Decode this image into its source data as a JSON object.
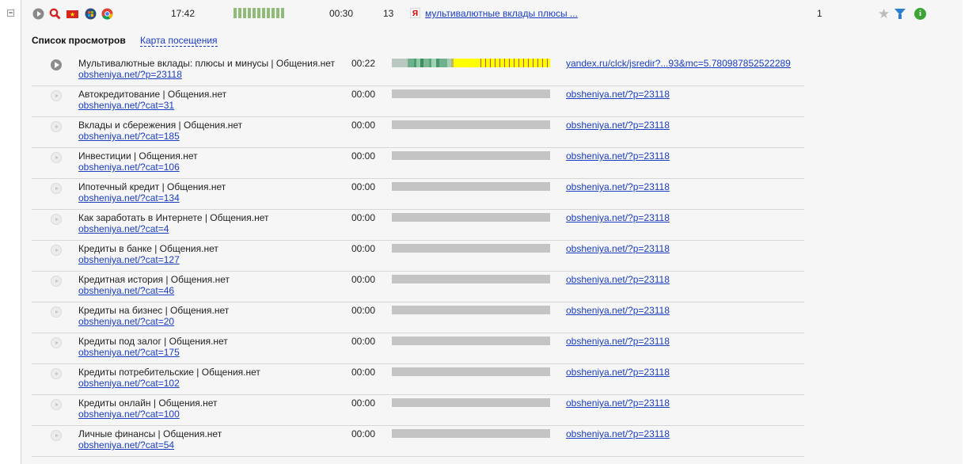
{
  "summary": {
    "time": "17:42",
    "duration": "00:30",
    "depth": "13",
    "link": "мультивалютные вклады плюсы ...",
    "count": "1"
  },
  "tabs": {
    "active": "Список просмотров",
    "link": "Карта посещения"
  },
  "activity_level": 1.0,
  "rows": [
    {
      "title": "Мультивалютные вклады: плюсы и минусы | Общения.нет",
      "url": "obsheniya.net/?p=23118",
      "duration": "00:22",
      "referrer": "yandex.ru/clck/jsredir?...93&mc=5.780987852522289",
      "active": true
    },
    {
      "title": "Автокредитование | Общения.нет",
      "url": "obsheniya.net/?cat=31",
      "duration": "00:00",
      "referrer": "obsheniya.net/?p=23118",
      "active": false
    },
    {
      "title": "Вклады и сбережения | Общения.нет",
      "url": "obsheniya.net/?cat=185",
      "duration": "00:00",
      "referrer": "obsheniya.net/?p=23118",
      "active": false
    },
    {
      "title": "Инвестиции | Общения.нет",
      "url": "obsheniya.net/?cat=106",
      "duration": "00:00",
      "referrer": "obsheniya.net/?p=23118",
      "active": false
    },
    {
      "title": "Ипотечный кредит | Общения.нет",
      "url": "obsheniya.net/?cat=134",
      "duration": "00:00",
      "referrer": "obsheniya.net/?p=23118",
      "active": false
    },
    {
      "title": "Как заработать в Интернете | Общения.нет",
      "url": "obsheniya.net/?cat=4",
      "duration": "00:00",
      "referrer": "obsheniya.net/?p=23118",
      "active": false
    },
    {
      "title": "Кредиты в банке | Общения.нет",
      "url": "obsheniya.net/?cat=127",
      "duration": "00:00",
      "referrer": "obsheniya.net/?p=23118",
      "active": false
    },
    {
      "title": "Кредитная история | Общения.нет",
      "url": "obsheniya.net/?cat=46",
      "duration": "00:00",
      "referrer": "obsheniya.net/?p=23118",
      "active": false
    },
    {
      "title": "Кредиты на бизнес | Общения.нет",
      "url": "obsheniya.net/?cat=20",
      "duration": "00:00",
      "referrer": "obsheniya.net/?p=23118",
      "active": false
    },
    {
      "title": "Кредиты под залог | Общения.нет",
      "url": "obsheniya.net/?cat=175",
      "duration": "00:00",
      "referrer": "obsheniya.net/?p=23118",
      "active": false
    },
    {
      "title": "Кредиты потребительские | Общения.нет",
      "url": "obsheniya.net/?cat=102",
      "duration": "00:00",
      "referrer": "obsheniya.net/?p=23118",
      "active": false
    },
    {
      "title": "Кредиты онлайн | Общения.нет",
      "url": "obsheniya.net/?cat=100",
      "duration": "00:00",
      "referrer": "obsheniya.net/?p=23118",
      "active": false
    },
    {
      "title": "Личные финансы | Общения.нет",
      "url": "obsheniya.net/?cat=54",
      "duration": "00:00",
      "referrer": "obsheniya.net/?p=23118",
      "active": false
    }
  ],
  "icons": [
    "expand-collapse-icon",
    "play-icon",
    "search-icon",
    "vietnam-flag-icon",
    "windows-icon",
    "chrome-icon",
    "yandex-icon",
    "star-icon",
    "filter-icon",
    "info-icon"
  ],
  "colors": {
    "link": "#1a3dc1",
    "activity": "#8fbc78",
    "timeline_active": "#ffff00",
    "timeline_inactive": "#c4c4c4"
  }
}
